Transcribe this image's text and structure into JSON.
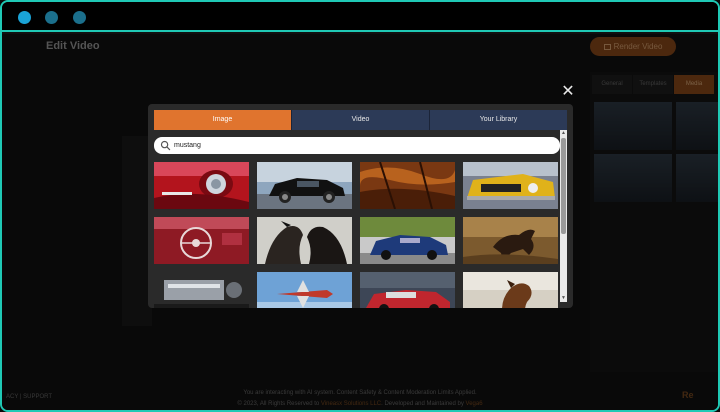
{
  "app": {
    "title": "Edit Video",
    "render_label": "Render Video",
    "side_tabs": [
      "General",
      "Templates",
      "Media"
    ]
  },
  "modal": {
    "tabs": [
      {
        "label": "Image",
        "active": true
      },
      {
        "label": "Video",
        "active": false
      },
      {
        "label": "Your Library",
        "active": false
      }
    ],
    "search": {
      "value": "mustang",
      "placeholder": "Search"
    },
    "images": [
      {
        "subject": "red car headlight"
      },
      {
        "subject": "black mustang side"
      },
      {
        "subject": "leather seat closeup"
      },
      {
        "subject": "yellow mustang front"
      },
      {
        "subject": "red car interior steering wheel"
      },
      {
        "subject": "two horses"
      },
      {
        "subject": "blue mustang front"
      },
      {
        "subject": "running horse"
      },
      {
        "subject": "engine chrome"
      },
      {
        "subject": "airplane sky"
      },
      {
        "subject": "red classic car"
      },
      {
        "subject": "brown horse portrait"
      }
    ]
  },
  "footer": {
    "left": "ACY | SUPPORT",
    "line1": "You are interacting with AI system. Content Safety & Content Moderation Limits Applied.",
    "line2_prefix": "© 2023, All Rights Reserved to",
    "line2_company": "Vineasx Solutions LLC",
    "line2_mid": ". Developed and Maintained by",
    "line2_dev": "Vega6",
    "brand": "Re"
  },
  "colors": {
    "accent": "#e0742e",
    "tab": "#2c3a57",
    "frame": "#1fc9b5"
  }
}
